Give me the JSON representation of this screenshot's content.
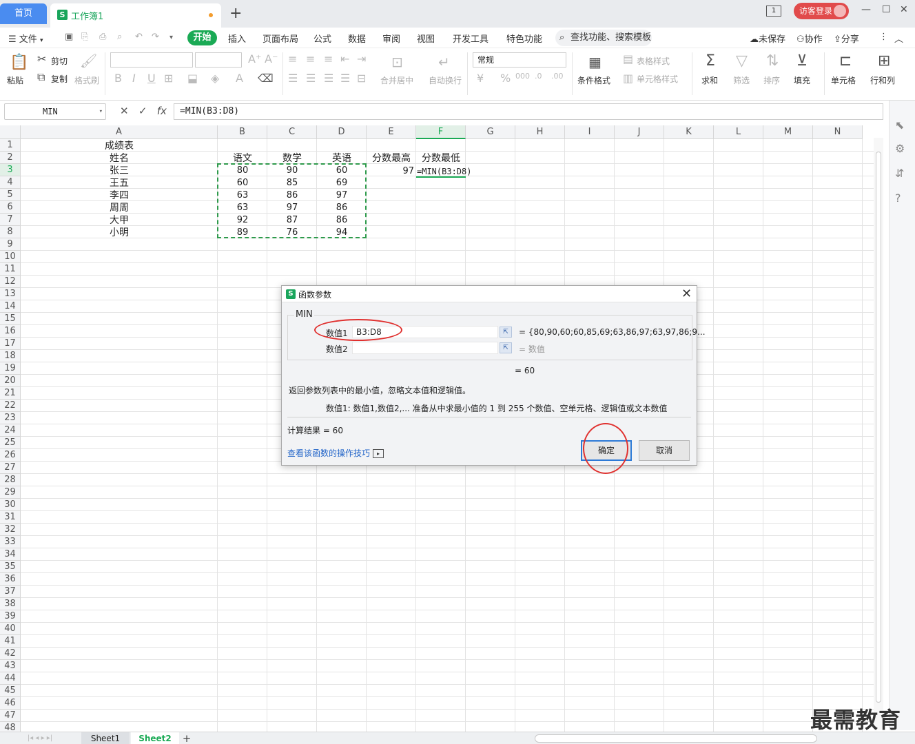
{
  "titlebar": {
    "home_tab": "首页",
    "doc_tab": "工作簿1",
    "doc_logo": "S",
    "add_tab": "+",
    "visitor_login": "访客登录",
    "badge": "1"
  },
  "menu": {
    "file": "文件",
    "start": "开始",
    "items": [
      "插入",
      "页面布局",
      "公式",
      "数据",
      "审阅",
      "视图",
      "开发工具",
      "特色功能"
    ],
    "search": "查找功能、搜索模板",
    "unsaved": "未保存",
    "collab": "协作",
    "share": "分享"
  },
  "ribbon": {
    "paste": "粘贴",
    "cut": "剪切",
    "copy": "复制",
    "format_painter": "格式刷",
    "number_format": "常规",
    "merge_center": "合并居中",
    "wrap_text": "自动换行",
    "cond_format": "条件格式",
    "table_style": "表格样式",
    "cell_style": "单元格样式",
    "sum": "求和",
    "filter": "筛选",
    "sort": "排序",
    "fill": "填充",
    "cell": "单元格",
    "row_col": "行和列"
  },
  "formula_bar": {
    "name_box": "MIN",
    "formula": "=MIN(B3:D8)"
  },
  "grid": {
    "columns": [
      "A",
      "B",
      "C",
      "D",
      "E",
      "F",
      "G",
      "H",
      "I",
      "J",
      "K",
      "L",
      "M",
      "N"
    ],
    "title": "成绩表",
    "header": {
      "name": "姓名",
      "chinese": "语文",
      "math": "数学",
      "english": "英语",
      "max": "分数最高",
      "min": "分数最低"
    },
    "rows": [
      {
        "name": "张三",
        "b": "80",
        "c": "90",
        "d": "60"
      },
      {
        "name": "王五",
        "b": "60",
        "c": "85",
        "d": "69"
      },
      {
        "name": "李四",
        "b": "63",
        "c": "86",
        "d": "97"
      },
      {
        "name": "周周",
        "b": "63",
        "c": "97",
        "d": "86"
      },
      {
        "name": "大甲",
        "b": "92",
        "c": "87",
        "d": "86"
      },
      {
        "name": "小明",
        "b": "89",
        "c": "76",
        "d": "94"
      }
    ],
    "e3": "97",
    "f3_editing": "=MIN(B3:D8)",
    "row_count": 48
  },
  "sheets": {
    "sheet1": "Sheet1",
    "sheet2": "Sheet2",
    "add": "+"
  },
  "watermark": "最需教育",
  "dialog": {
    "title": "函数参数",
    "logo": "S",
    "function_name": "MIN",
    "arg1_label": "数值1",
    "arg1_value": "B3:D8",
    "arg1_result": "= {80,90,60;60,85,69;63,86,97;63,97,86;9...",
    "arg2_label": "数值2",
    "arg2_result": "= 数值",
    "result_line": "= 60",
    "description": "返回参数列表中的最小值，忽略文本值和逻辑值。",
    "arg_description": "数值1:   数值1,数值2,... 准备从中求最小值的 1 到 255 个数值、空单元格、逻辑值或文本数值",
    "calc_result": "计算结果  =  60",
    "help_link": "查看该函数的操作技巧",
    "ok": "确定",
    "cancel": "取消"
  },
  "colors": {
    "accent_green": "#1aaa55",
    "home_blue": "#4a8cf0",
    "annotation_red": "#e0302e",
    "visitor_red": "#e14b4b"
  }
}
